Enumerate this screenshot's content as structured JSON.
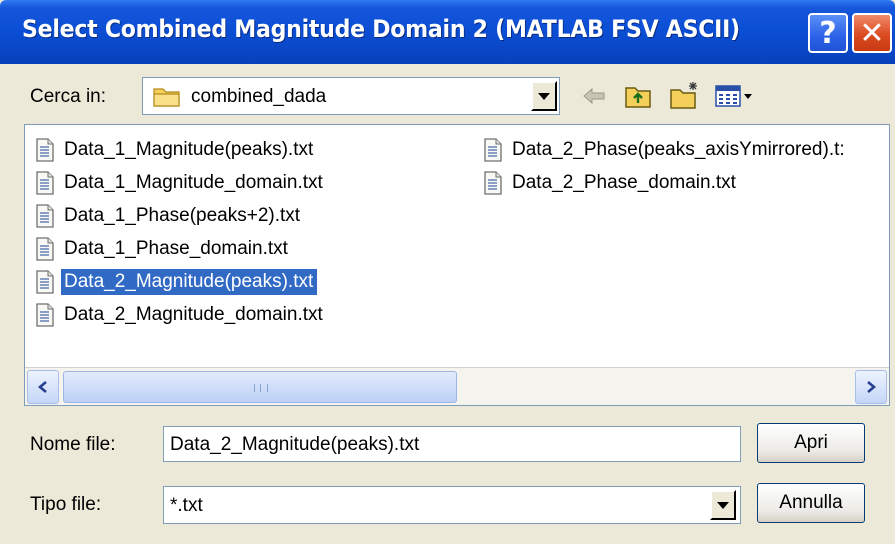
{
  "window": {
    "title": "Select Combined Magnitude Domain 2 (MATLAB FSV ASCII)",
    "help_glyph": "?",
    "close_glyph": "✕"
  },
  "look_in": {
    "label": "Cerca in:",
    "folder_name": "combined_dada",
    "folder_icon": "folder-icon"
  },
  "toolbar": {
    "icons": [
      "back-arrow-icon",
      "up-folder-icon",
      "new-folder-icon",
      "view-menu-icon"
    ]
  },
  "files": {
    "column1": [
      "Data_1_Magnitude(peaks).txt",
      "Data_1_Magnitude_domain.txt",
      "Data_1_Phase(peaks+2).txt",
      "Data_1_Phase_domain.txt",
      "Data_2_Magnitude(peaks).txt",
      "Data_2_Magnitude_domain.txt"
    ],
    "column2": [
      "Data_2_Phase(peaks_axisYmirrored).t:",
      "Data_2_Phase_domain.txt"
    ],
    "selected": "Data_2_Magnitude(peaks).txt",
    "scroll_grip": "III"
  },
  "file_name": {
    "label": "Nome file:",
    "value": "Data_2_Magnitude(peaks).txt"
  },
  "file_type": {
    "label": "Tipo file:",
    "value": "*.txt"
  },
  "buttons": {
    "open": "Apri",
    "cancel": "Annulla"
  },
  "colors": {
    "title_bar": "#0b4fd6",
    "selection": "#316ac5",
    "dialog_bg": "#ece9d8"
  }
}
